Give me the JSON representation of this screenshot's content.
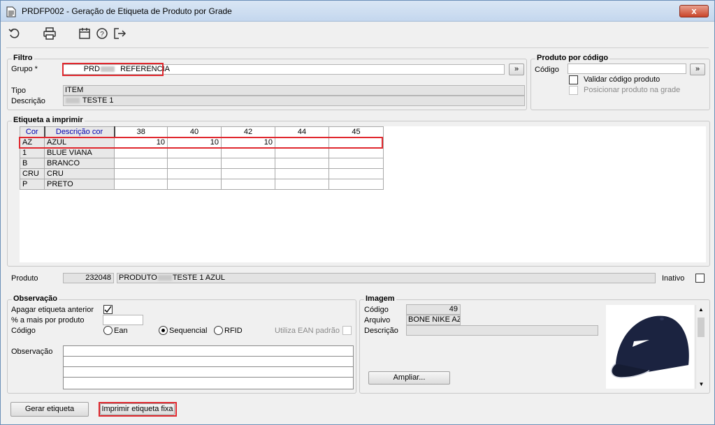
{
  "window": {
    "title": "PRDFP002 - Geração de Etiqueta de Produto por Grade",
    "close": "x"
  },
  "toolbar": {
    "icons": [
      "refresh-icon",
      "print-icon",
      "calendar-icon",
      "help-icon",
      "exit-icon"
    ]
  },
  "filtro": {
    "legend": "Filtro",
    "grupo_label": "Grupo *",
    "grupo_code": "PRD",
    "grupo_value": "REFERENCIA",
    "go_button": "»",
    "tipo_label": "Tipo",
    "tipo_value": "ITEM",
    "descricao_label": "Descrição",
    "descricao_value": "TESTE 1"
  },
  "produto_codigo": {
    "legend": "Produto por código",
    "codigo_label": "Código",
    "codigo_value": "",
    "go_button": "»",
    "validar_label": "Validar código produto",
    "posicionar_label": "Posicionar produto na grade"
  },
  "etiqueta": {
    "legend": "Etiqueta a imprimir",
    "headers": [
      "Cor",
      "Descrição cor",
      "38",
      "40",
      "42",
      "44",
      "45"
    ],
    "rows": [
      {
        "cor": "AZ",
        "desc": "AZUL",
        "vals": [
          "10",
          "10",
          "10",
          "",
          ""
        ]
      },
      {
        "cor": "1",
        "desc": "BLUE VIANA",
        "vals": [
          "",
          "",
          "",
          "",
          ""
        ]
      },
      {
        "cor": "B",
        "desc": "BRANCO",
        "vals": [
          "",
          "",
          "",
          "",
          ""
        ]
      },
      {
        "cor": "CRU",
        "desc": "CRU",
        "vals": [
          "",
          "",
          "",
          "",
          ""
        ]
      },
      {
        "cor": "P",
        "desc": "PRETO",
        "vals": [
          "",
          "",
          "",
          "",
          ""
        ]
      }
    ]
  },
  "produto": {
    "label": "Produto",
    "code": "232048",
    "desc_prefix": "PRODUTO",
    "desc_suffix": "TESTE 1 AZUL",
    "inativo_label": "Inativo"
  },
  "observacao": {
    "legend": "Observação",
    "apagar_label": "Apagar etiqueta anterior",
    "pct_label": "% a mais por produto",
    "pct_value": "",
    "codigo_label": "Código",
    "radios": [
      "Ean",
      "Sequencial",
      "RFID"
    ],
    "utiliza_label": "Utiliza EAN padrão",
    "obs_label": "Observação"
  },
  "imagem": {
    "legend": "Imagem",
    "codigo_label": "Código",
    "codigo_value": "49",
    "arquivo_label": "Arquivo",
    "arquivo_value": "BONE NIKE AZU",
    "descricao_label": "Descrição",
    "descricao_value": "",
    "ampliar": "Ampliar..."
  },
  "footer": {
    "gerar": "Gerar etiqueta",
    "imprimir": "Imprimir etiqueta fixa"
  },
  "colors": {
    "highlight": "#e0282e",
    "header_text": "#0000b0"
  }
}
